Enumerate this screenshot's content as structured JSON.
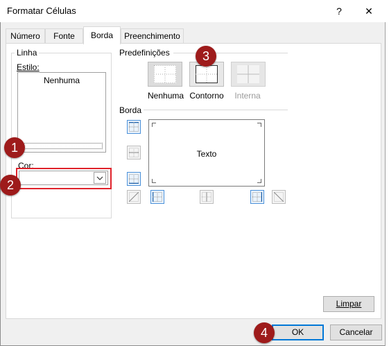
{
  "window": {
    "title": "Formatar Células",
    "help": "?",
    "close": "✕"
  },
  "tabs": [
    {
      "label": "Número"
    },
    {
      "label": "Fonte"
    },
    {
      "label": "Borda"
    },
    {
      "label": "Preenchimento"
    }
  ],
  "linha": {
    "group_label": "Linha",
    "estilo_label": "Estilo:",
    "style_value": "Nenhuma",
    "cor_label": "Cor:",
    "color_value": ""
  },
  "predefinicoes": {
    "label": "Predefinições",
    "presets": [
      {
        "label": "Nenhuma",
        "enabled": true
      },
      {
        "label": "Contorno",
        "enabled": true
      },
      {
        "label": "Interna",
        "enabled": false
      }
    ]
  },
  "borda": {
    "label": "Borda",
    "preview_text": "Texto"
  },
  "buttons": {
    "limpar": "Limpar",
    "ok": "OK",
    "cancelar": "Cancelar"
  },
  "annotations": [
    "1",
    "2",
    "3",
    "4"
  ],
  "colors": {
    "highlight": "#e0222b",
    "badge": "#9e1b1b",
    "accent": "#0078d7"
  }
}
